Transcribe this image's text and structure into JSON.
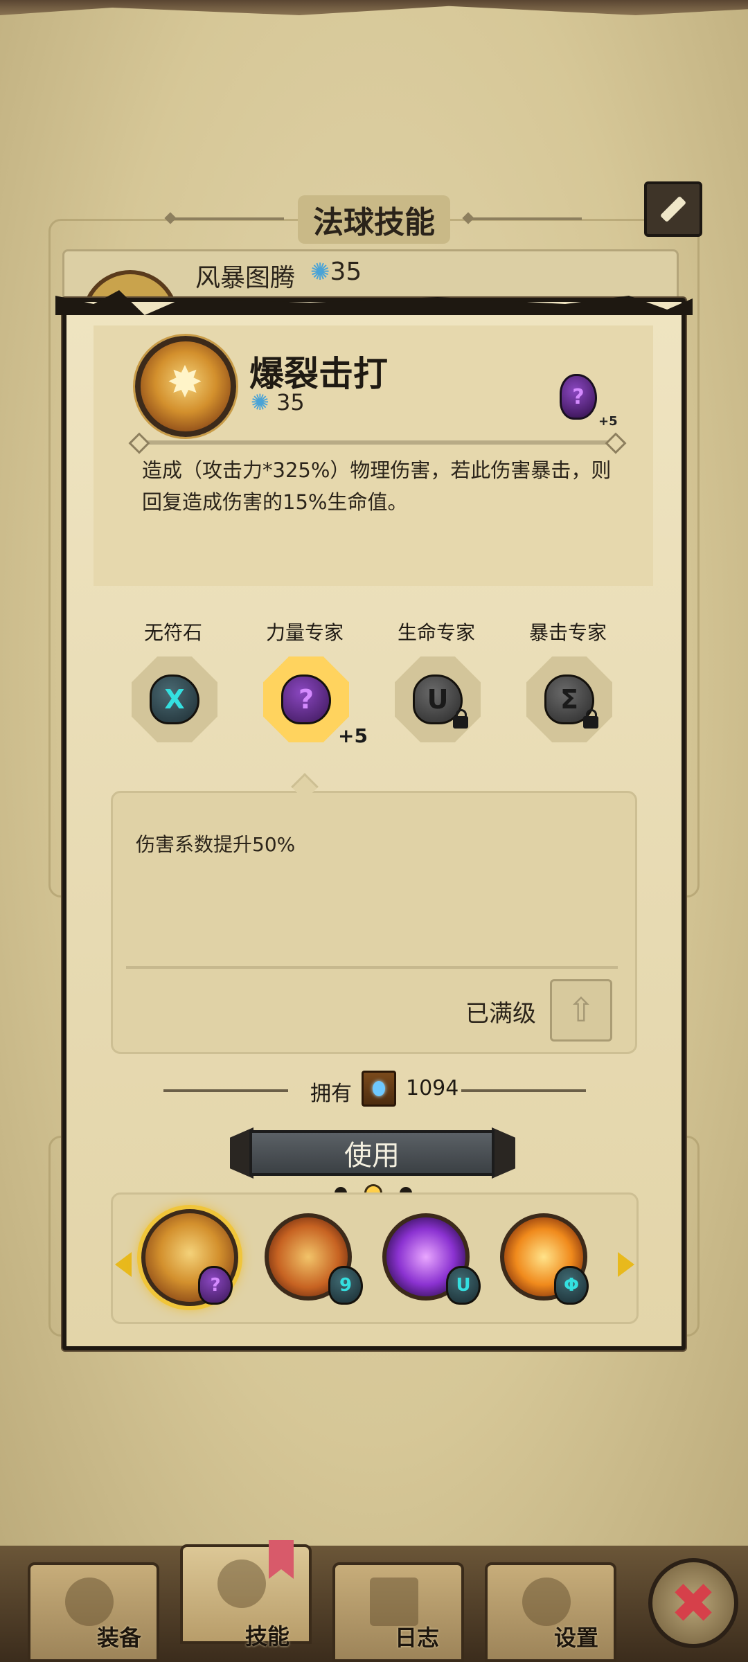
{
  "header": {
    "title": "法球技能"
  },
  "back_card": {
    "skill_name": "风暴图腾",
    "cost": "35"
  },
  "skill": {
    "name": "爆裂击打",
    "cost": "35",
    "rune_bonus": "+5",
    "rune_symbol": "?",
    "description": "造成（攻击力*325%）物理伤害，若此伤害暴击，则回复造成伤害的15%生命值。"
  },
  "runes": [
    {
      "label": "无符石",
      "symbol": "X",
      "color": "teal",
      "locked": false,
      "selected": false
    },
    {
      "label": "力量专家",
      "symbol": "?",
      "color": "purple",
      "locked": false,
      "selected": true,
      "bonus": "+5"
    },
    {
      "label": "生命专家",
      "symbol": "U",
      "color": "gray",
      "locked": true,
      "selected": false
    },
    {
      "label": "暴击专家",
      "symbol": "Σ",
      "color": "gray",
      "locked": true,
      "selected": false
    }
  ],
  "rune_detail": {
    "text": "伤害系数提升50%",
    "status": "已满级"
  },
  "owned": {
    "label": "拥有",
    "count": "1094"
  },
  "use_button": "使用",
  "pager": {
    "total": 3,
    "current": 2
  },
  "carousel": [
    {
      "name": "skill-burst-strike",
      "rune": "?",
      "rune_color": "purple"
    },
    {
      "name": "skill-shield",
      "rune": "9",
      "rune_color": "teal"
    },
    {
      "name": "skill-claw",
      "rune": "U",
      "rune_color": "teal"
    },
    {
      "name": "skill-fist",
      "rune": "Φ",
      "rune_color": "teal"
    }
  ],
  "nav": {
    "tabs": [
      {
        "label": "装备",
        "icon": "axe-icon"
      },
      {
        "label": "技能",
        "icon": "skill-icon"
      },
      {
        "label": "日志",
        "icon": "journal-icon"
      },
      {
        "label": "设置",
        "icon": "gear-icon"
      }
    ],
    "active": 1,
    "close_symbol": "✖"
  },
  "colors": {
    "parchment": "#e7dab2",
    "accent_gold": "#f0c53a",
    "rune_purple": "#d58bff",
    "rune_teal": "#34e0e0",
    "close_red": "#d6404a"
  }
}
